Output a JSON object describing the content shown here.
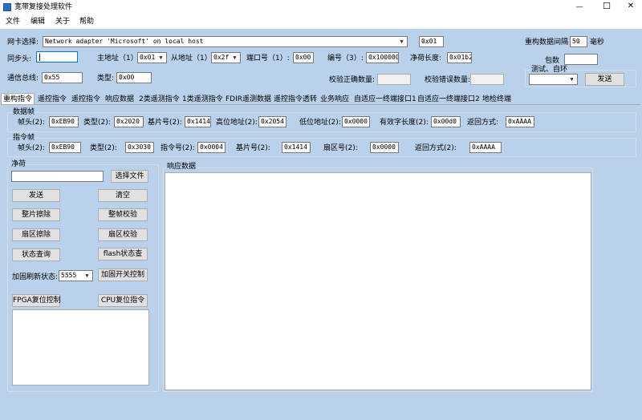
{
  "window": {
    "title": "宽带复接处理软件",
    "controls": {
      "minimize": "—",
      "maximize": "☐",
      "close": "✕"
    }
  },
  "menu": [
    "文件",
    "编辑",
    "关于",
    "帮助"
  ],
  "top": {
    "nic_label": "网卡选择:",
    "nic_value": "Network adapter 'Microsoft' on local host",
    "nic_hex": "0x01",
    "reconstruct_interval_label": "重构数据间隔",
    "reconstruct_interval_value": "50",
    "ms_label": "毫秒",
    "sync_label": "同步头:",
    "sync_value": "",
    "main_addr_label": "主地址（1）",
    "main_addr_value": "0x01",
    "slave_addr_label": "从地址（1）",
    "slave_addr_value": "0x2f",
    "port_label": "端口号（1）:",
    "port_value": "0x00",
    "code_label": "编号（3）:",
    "code_value": "0x100000",
    "payload_len_label": "净荷长度:",
    "payload_len_value": "0x01b2",
    "packet_count_label": "包数",
    "packet_count_value": "",
    "bus_label": "通信总线:",
    "bus_value": "0x55",
    "type_label": "类型:",
    "type_value": "0x00",
    "check_ok_label": "校验正确数量:",
    "check_ok_value": "",
    "check_err_label": "校验错误数量:",
    "check_err_value": "",
    "test_group_title": "测试、自环",
    "test_select_value": "",
    "send_button": "发送"
  },
  "tabs": [
    "重构指令",
    "遥控指令",
    "遥控指令",
    "响应数据",
    "2类遥测指令",
    "1类遥测指令",
    "FDIR遥测数据",
    "遥控指令透转",
    "业务响应",
    "自适应一终端接口1",
    "自适应一终端接口2",
    "地检终端"
  ],
  "data_frame": {
    "title": "数据帧",
    "fields": [
      {
        "label": "帧头(2):",
        "value": "0xEB90"
      },
      {
        "label": "类型(2):",
        "value": "0x2020"
      },
      {
        "label": "基片号(2):",
        "value": "0x1414"
      },
      {
        "label": "高位地址(2):",
        "value": "0x2054"
      },
      {
        "label": "低位地址(2):",
        "value": "0x0000"
      },
      {
        "label": "有效字长度(2):",
        "value": "0x00d0"
      },
      {
        "label": "返回方式:",
        "value": "0xAAAA"
      }
    ]
  },
  "cmd_frame": {
    "title": "指令帧",
    "fields": [
      {
        "label": "帧头(2):",
        "value": "0xEB90"
      },
      {
        "label": "类型(2):",
        "value": "0x3030"
      },
      {
        "label": "指令号(2):",
        "value": "0x0004"
      },
      {
        "label": "基片号(2):",
        "value": "0x1414"
      },
      {
        "label": "扇区号(2):",
        "value": "0x0000"
      },
      {
        "label": "返回方式(2):",
        "value": "0xAAAA"
      }
    ]
  },
  "payload": {
    "title": "净荷",
    "file_value": "",
    "select_file": "选择文件",
    "send": "发送",
    "clear": "清空",
    "chip_erase": "整片擦除",
    "frame_check": "整帧校验",
    "sector_erase": "扇区擦除",
    "sector_check": "扇区校验",
    "status_query": "状态查询",
    "flash_status": "flash状态查",
    "reinforce_label": "加固刷新状态:",
    "reinforce_value": "5555",
    "reinforce_switch": "加固开关控制",
    "fpga_reset": "FPGA复位控制",
    "cpu_reset": "CPU复位指令",
    "log_text": ""
  },
  "response": {
    "title": "响应数据",
    "text": ""
  }
}
